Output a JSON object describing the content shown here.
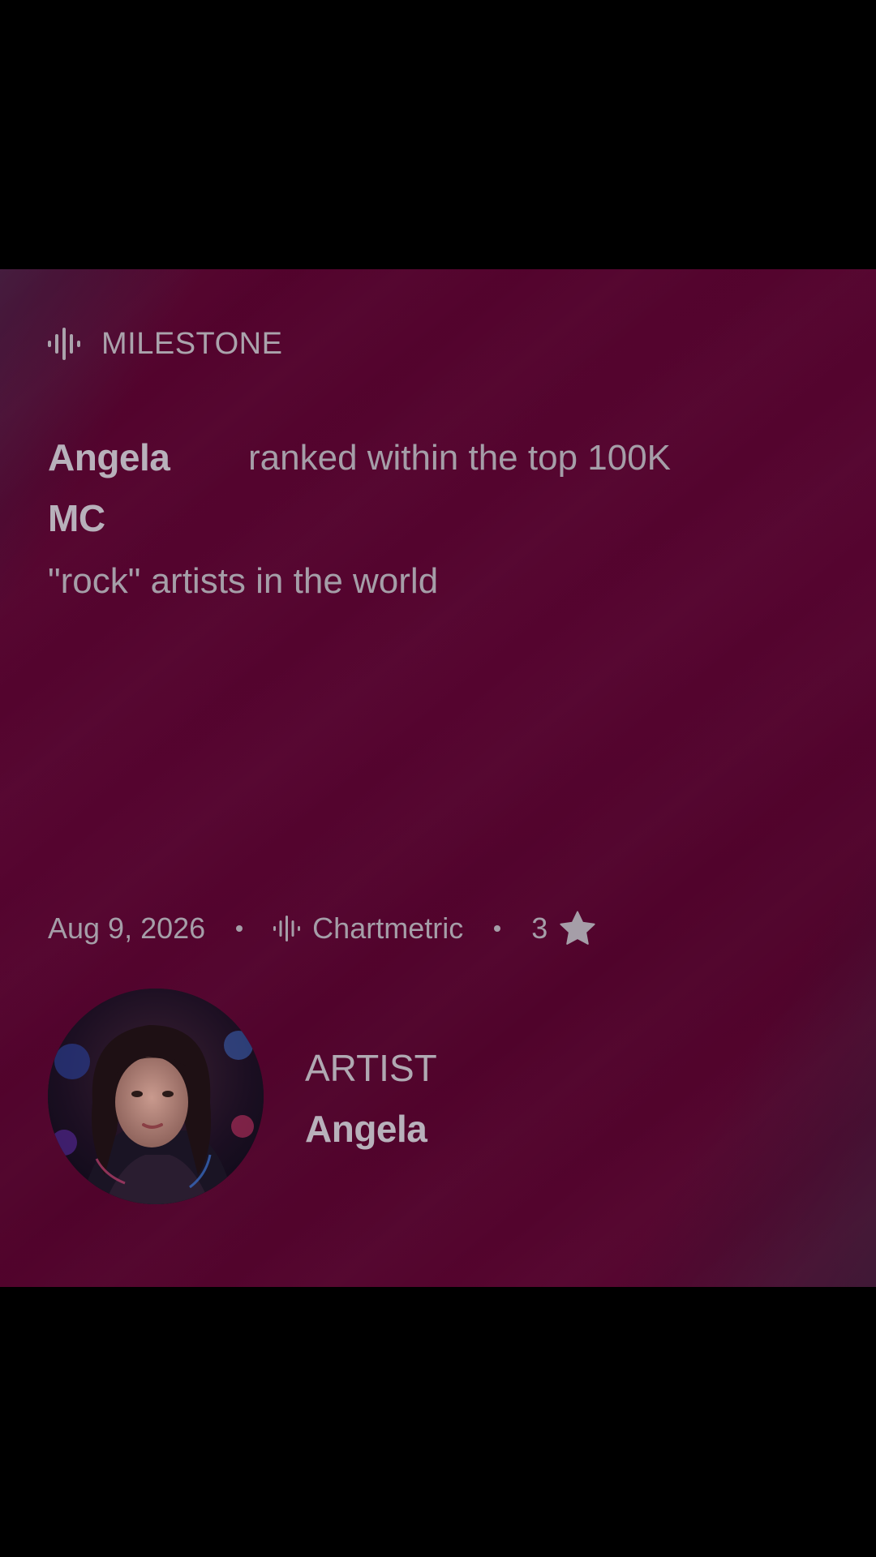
{
  "card": {
    "category": {
      "icon": "sound-wave-icon",
      "label": "MILESTONE"
    },
    "headline": {
      "artist_line1": "Angela",
      "artist_line2": "MC",
      "text_line1": "ranked within the top 100K",
      "text_line2": "\"rock\" artists in the world"
    },
    "meta": {
      "date": "Aug 9, 2026",
      "source_icon": "sound-wave-icon",
      "source": "Chartmetric",
      "rating": "3",
      "rating_icon": "star-icon"
    },
    "artist": {
      "kicker": "ARTIST",
      "name": "Angela"
    }
  },
  "colors": {
    "page_background": "#000000",
    "card_background": "#52032c",
    "text_primary": "#b8b1bb",
    "text_secondary": "#a59ea8"
  }
}
